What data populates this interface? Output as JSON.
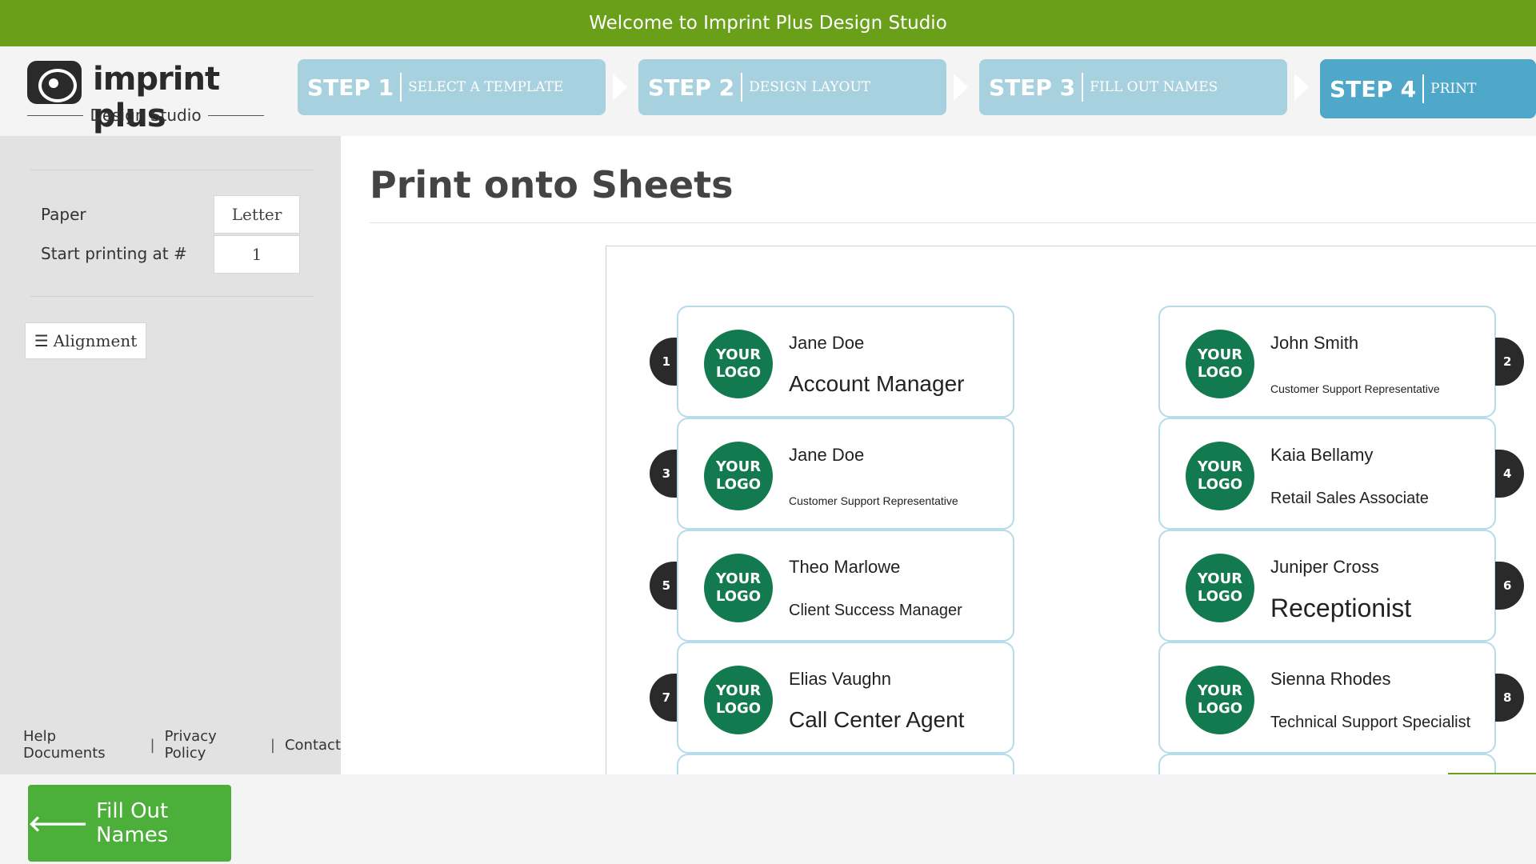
{
  "welcome": {
    "text": "Welcome to Imprint Plus Design Studio"
  },
  "brand": {
    "name": "imprint plus",
    "subtitle": "Design Studio"
  },
  "steps": [
    {
      "num": "STEP 1",
      "label": "SELECT A TEMPLATE",
      "active": false
    },
    {
      "num": "STEP 2",
      "label": "DESIGN LAYOUT",
      "active": false
    },
    {
      "num": "STEP 3",
      "label": "FILL OUT NAMES",
      "active": false
    },
    {
      "num": "STEP 4",
      "label": "PRINT",
      "active": true
    }
  ],
  "sidebar": {
    "paper_label": "Paper",
    "paper_value": "Letter",
    "start_label": "Start printing at #",
    "start_value": "1",
    "alignment_label": "Alignment",
    "footer": {
      "help": "Help Documents",
      "privacy": "Privacy Policy",
      "contact": "Contact"
    }
  },
  "main": {
    "title": "Print onto Sheets"
  },
  "labels": [
    {
      "n": "1",
      "name": "Jane Doe",
      "title": "Account Manager",
      "size": "lg",
      "logo": "YOUR\nLOGO"
    },
    {
      "n": "2",
      "name": "John Smith",
      "title": "Customer Support Representative",
      "size": "sm",
      "logo": "YOUR\nLOGO"
    },
    {
      "n": "3",
      "name": "Jane Doe",
      "title": "Customer Support Representative",
      "size": "sm",
      "logo": "YOUR\nLOGO"
    },
    {
      "n": "4",
      "name": "Kaia Bellamy",
      "title": "Retail Sales Associate",
      "size": "md",
      "logo": "YOUR\nLOGO"
    },
    {
      "n": "5",
      "name": "Theo Marlowe",
      "title": "Client Success Manager",
      "size": "md",
      "logo": "YOUR\nLOGO"
    },
    {
      "n": "6",
      "name": "Juniper Cross",
      "title": "Receptionist",
      "size": "xl",
      "logo": "YOUR\nLOGO"
    },
    {
      "n": "7",
      "name": "Elias Vaughn",
      "title": "Call Center Agent",
      "size": "lg",
      "logo": "YOUR\nLOGO"
    },
    {
      "n": "8",
      "name": "Sienna Rhodes",
      "title": "Technical Support Specialist",
      "size": "md",
      "logo": "YOUR\nLOGO"
    }
  ],
  "bottom": {
    "fill_button": "Fill Out Names"
  },
  "colors": {
    "brand_green": "#6a9f1a",
    "step_inactive": "#a8d1df",
    "step_active": "#4fa7c9",
    "logo_green": "#137a4f",
    "button_green": "#4caf3a"
  }
}
